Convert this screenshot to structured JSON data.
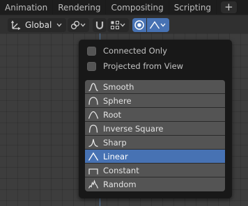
{
  "workspace_tabs": [
    "Animation",
    "Rendering",
    "Compositing",
    "Scripting"
  ],
  "add_workspace_label": "+",
  "header": {
    "orientation_label": "Global",
    "orientation_icon": "transform-orientation-icon",
    "pivot_icon": "pivot-point-icon",
    "snap_icon": "snap-magnet-icon",
    "snap_target_icon": "snap-increment-icon",
    "proportional_icon": "proportional-editing-icon",
    "falloff_icon": "falloff-linear-icon"
  },
  "popup": {
    "options": [
      {
        "label": "Connected Only",
        "checked": false
      },
      {
        "label": "Projected from View",
        "checked": false
      }
    ],
    "falloff_items": [
      {
        "label": "Smooth",
        "icon": "smooth-curve-icon",
        "selected": false
      },
      {
        "label": "Sphere",
        "icon": "sphere-curve-icon",
        "selected": false
      },
      {
        "label": "Root",
        "icon": "root-curve-icon",
        "selected": false
      },
      {
        "label": "Inverse Square",
        "icon": "inverse-square-curve-icon",
        "selected": false
      },
      {
        "label": "Sharp",
        "icon": "sharp-curve-icon",
        "selected": false
      },
      {
        "label": "Linear",
        "icon": "linear-curve-icon",
        "selected": true
      },
      {
        "label": "Constant",
        "icon": "constant-curve-icon",
        "selected": false
      },
      {
        "label": "Random",
        "icon": "random-curve-icon",
        "selected": false
      }
    ]
  },
  "colors": {
    "accent": "#4772b3",
    "background": "#3d3d3d",
    "menu_background": "#181818",
    "item_background": "#545454",
    "y_axis": "#4f78a6"
  }
}
